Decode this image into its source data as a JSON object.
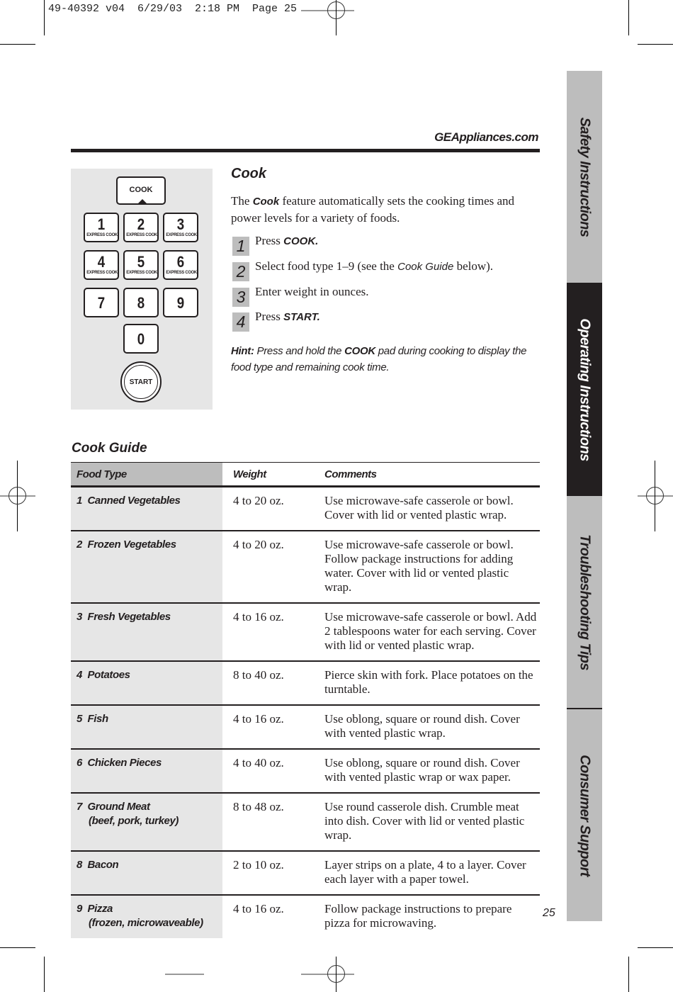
{
  "print_slug": "49-40392 v04  6/29/03  2:18 PM  Page 25",
  "header": {
    "website": "GEAppliances.com"
  },
  "keypad": {
    "cook_label": "COOK",
    "keys": [
      {
        "num": "1",
        "sub": "EXPRESS COOK"
      },
      {
        "num": "2",
        "sub": "EXPRESS COOK"
      },
      {
        "num": "3",
        "sub": "EXPRESS COOK"
      },
      {
        "num": "4",
        "sub": "EXPRESS COOK"
      },
      {
        "num": "5",
        "sub": "EXPRESS COOK"
      },
      {
        "num": "6",
        "sub": "EXPRESS COOK"
      },
      {
        "num": "7",
        "sub": ""
      },
      {
        "num": "8",
        "sub": ""
      },
      {
        "num": "9",
        "sub": ""
      },
      {
        "num": "0",
        "sub": ""
      }
    ],
    "start_label": "START"
  },
  "cook": {
    "title": "Cook",
    "intro_prefix": "The ",
    "intro_emph": "Cook",
    "intro_rest": " feature automatically sets the cooking times and power levels for a variety of foods.",
    "steps": [
      {
        "n": "1",
        "pre": "Press ",
        "emph": "COOK.",
        "post": ""
      },
      {
        "n": "2",
        "pre": "Select food type 1–9 (see the ",
        "emph": "Cook Guide",
        "post": " below)."
      },
      {
        "n": "3",
        "pre": "Enter weight in ounces.",
        "emph": "",
        "post": ""
      },
      {
        "n": "4",
        "pre": "Press ",
        "emph": "START.",
        "post": ""
      }
    ],
    "hint_label": "Hint:",
    "hint_pre": " Press and hold the ",
    "hint_emph": "COOK",
    "hint_post": " pad during cooking to display the food type and remaining cook time."
  },
  "guide": {
    "title": "Cook Guide",
    "headers": {
      "food": "Food Type",
      "weight": "Weight",
      "comments": "Comments"
    },
    "rows": [
      {
        "food": "1  Canned Vegetables",
        "food_sub": "",
        "weight": "4 to 20 oz.",
        "comment": "Use microwave-safe casserole or bowl. Cover with lid or vented plastic wrap."
      },
      {
        "food": "2  Frozen Vegetables",
        "food_sub": "",
        "weight": "4 to 20 oz.",
        "comment": "Use microwave-safe casserole or bowl. Follow package instructions for adding water. Cover with lid or vented plastic wrap."
      },
      {
        "food": "3  Fresh Vegetables",
        "food_sub": "",
        "weight": "4 to 16 oz.",
        "comment": "Use microwave-safe casserole or bowl. Add 2 tablespoons water for each serving. Cover with lid or vented plastic wrap."
      },
      {
        "food": "4  Potatoes",
        "food_sub": "",
        "weight": "8 to 40 oz.",
        "comment": "Pierce skin with fork. Place potatoes on the turntable."
      },
      {
        "food": "5  Fish",
        "food_sub": "",
        "weight": "4 to 16 oz.",
        "comment": "Use oblong, square or round dish. Cover with vented plastic wrap."
      },
      {
        "food": "6  Chicken Pieces",
        "food_sub": "",
        "weight": "4 to 40 oz.",
        "comment": "Use oblong, square or round dish. Cover with vented plastic wrap or wax paper."
      },
      {
        "food": "7  Ground Meat",
        "food_sub": "(beef, pork, turkey)",
        "weight": "8 to 48 oz.",
        "comment": "Use round casserole dish. Crumble meat into dish. Cover with lid or vented plastic wrap."
      },
      {
        "food": "8  Bacon",
        "food_sub": "",
        "weight": "2 to 10 oz.",
        "comment": "Layer strips on a plate, 4 to a layer. Cover each layer with a paper towel."
      },
      {
        "food": "9  Pizza",
        "food_sub": "(frozen, microwaveable)",
        "weight": "4 to 16 oz.",
        "comment": "Follow package instructions to prepare pizza for microwaving."
      }
    ]
  },
  "side_tabs": [
    {
      "label": "Safety Instructions",
      "active": false
    },
    {
      "label": "Operating Instructions",
      "active": true
    },
    {
      "label": "Troubleshooting Tips",
      "active": false
    },
    {
      "label": "Consumer Support",
      "active": false
    }
  ],
  "page_number": "25"
}
